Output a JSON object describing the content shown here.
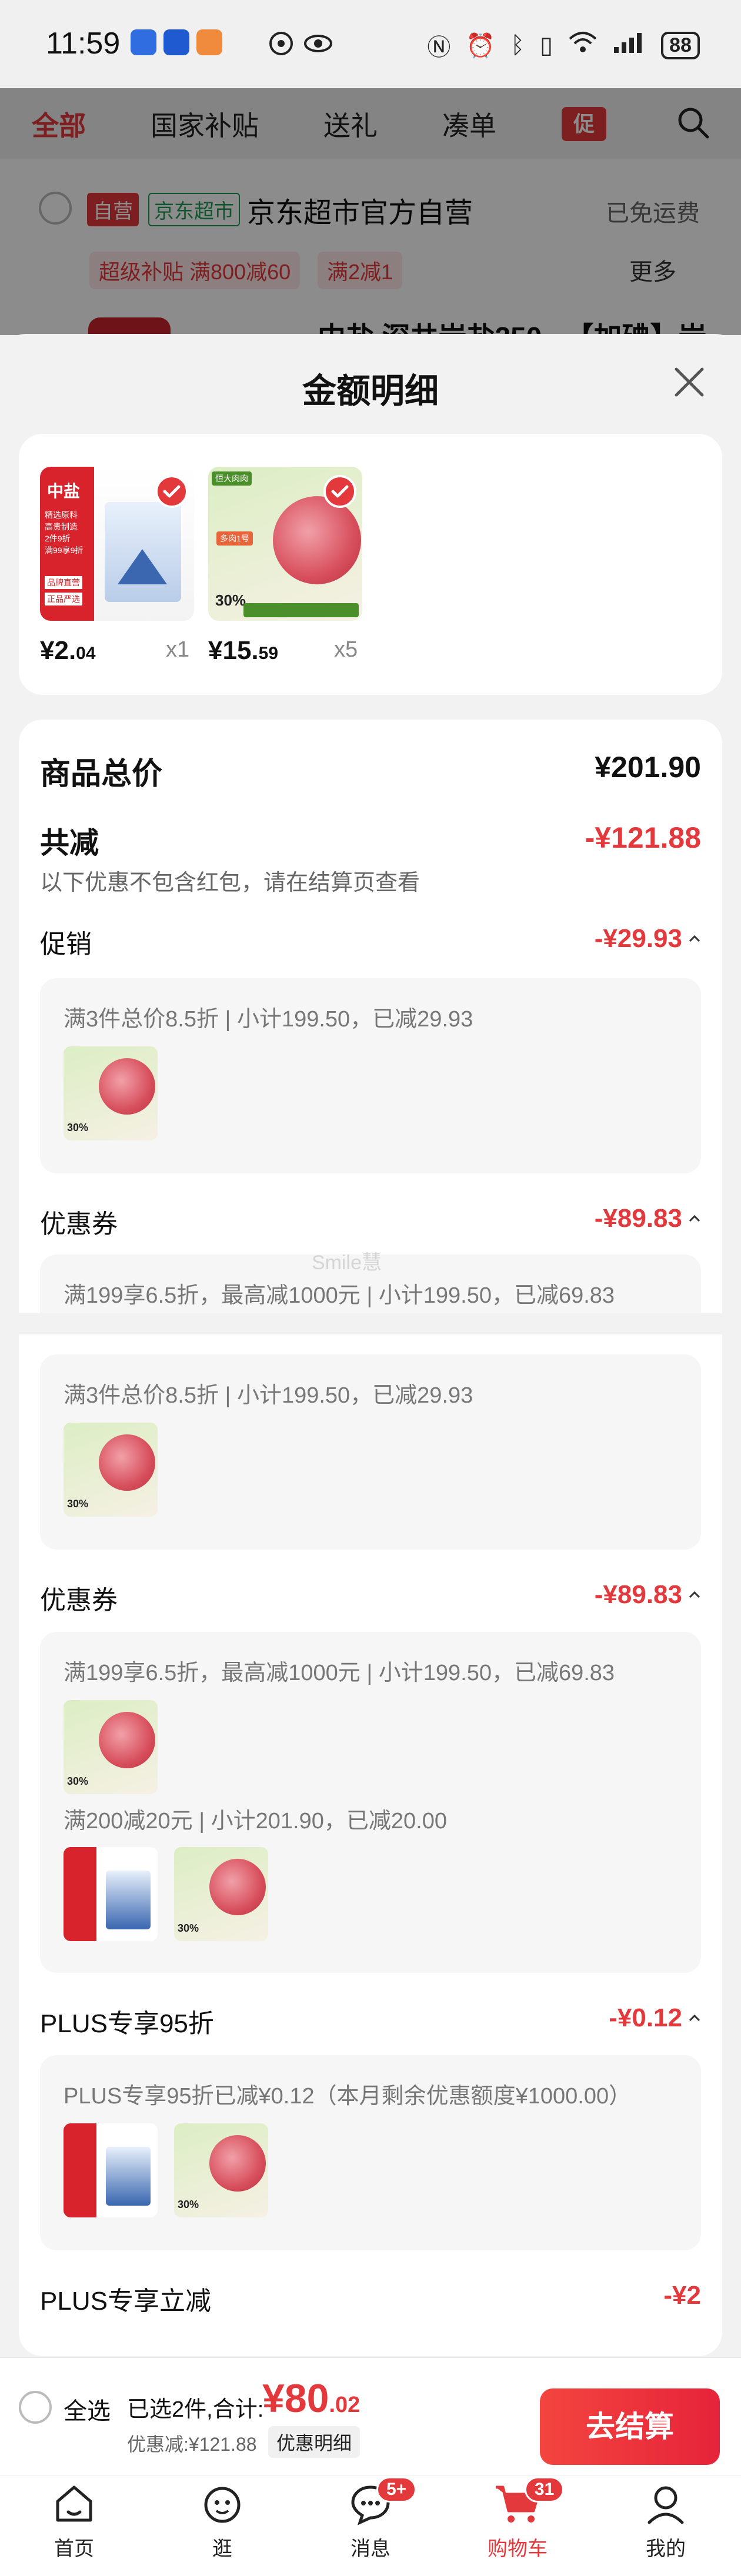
{
  "status": {
    "time": "11:59",
    "battery": "88",
    "signal_text": "‡"
  },
  "categories": {
    "items": [
      "全部",
      "国家补贴",
      "送礼",
      "凑单"
    ],
    "promo_tag": "促"
  },
  "store": {
    "badge_self": "自营",
    "badge_market": "京东超市",
    "name": "京东超市官方自营",
    "shipping": "已免运费",
    "tags": [
      "超级补贴 满800减60",
      "满2减1"
    ],
    "more": "更多",
    "next_item": "中盐 深井岩盐250...【加碘】岩"
  },
  "modal": {
    "title": "金额明细",
    "products": [
      {
        "price_int": "¥2.",
        "price_dec": "04",
        "qty": "x1"
      },
      {
        "price_int": "¥15.",
        "price_dec": "59",
        "qty": "x5"
      }
    ],
    "total_label": "商品总价",
    "total_value": "¥201.90",
    "reduce_label": "共减",
    "reduce_value": "-¥121.88",
    "reduce_note": "以下优惠不包含红包，请在结算页查看",
    "promo_label": "促销",
    "promo_value": "-¥29.93",
    "promo_rule_1": "满3件总价8.5折 | 小计199.50，已减29.93",
    "coupon_label": "优惠券",
    "coupon_value": "-¥89.83",
    "coupon_rule_1": "满199享6.5折，最高减1000元 | 小计199.50，已减69.83",
    "promo_rule_2": "满3件总价8.5折 | 小计199.50，已减29.93",
    "coupon_label_2": "优惠券",
    "coupon_value_2": "-¥89.83",
    "coupon_rule_2": "满199享6.5折，最高减1000元 | 小计199.50，已减69.83",
    "coupon_rule_3": "满200减20元 | 小计201.90，已减20.00",
    "plus95_label": "PLUS专享95折",
    "plus95_value": "-¥0.12",
    "plus95_rule": "PLUS专享95折已减¥0.12（本月剩余优惠额度¥1000.00）",
    "plus_reduce_label": "PLUS专享立减",
    "plus_reduce_value": "-¥2"
  },
  "watermark": "Smile慧",
  "product_art": {
    "salt_brand": "中盐",
    "salt_lines": [
      "精选原料",
      "高贵制造",
      "2件9折",
      "满99享9折"
    ],
    "salt_tags": [
      "品牌直营",
      "正品严选"
    ],
    "meat_brand": "恒大肉肉",
    "meat_sub": "多肉1号",
    "meat_pct": "30%"
  },
  "bottom": {
    "select_all": "全选",
    "selected_text": "已选2件,合计:",
    "total_int": "¥80",
    "total_dec": ".02",
    "discount_text": "优惠减:¥121.88",
    "detail_btn": "优惠明细",
    "checkout": "去结算"
  },
  "nav": {
    "items": [
      "首页",
      "逛",
      "消息",
      "购物车",
      "我的"
    ],
    "msg_badge": "5+",
    "cart_badge": "31"
  },
  "colors": {
    "accent": "#e4393c",
    "jd_green": "#1e9c52"
  }
}
